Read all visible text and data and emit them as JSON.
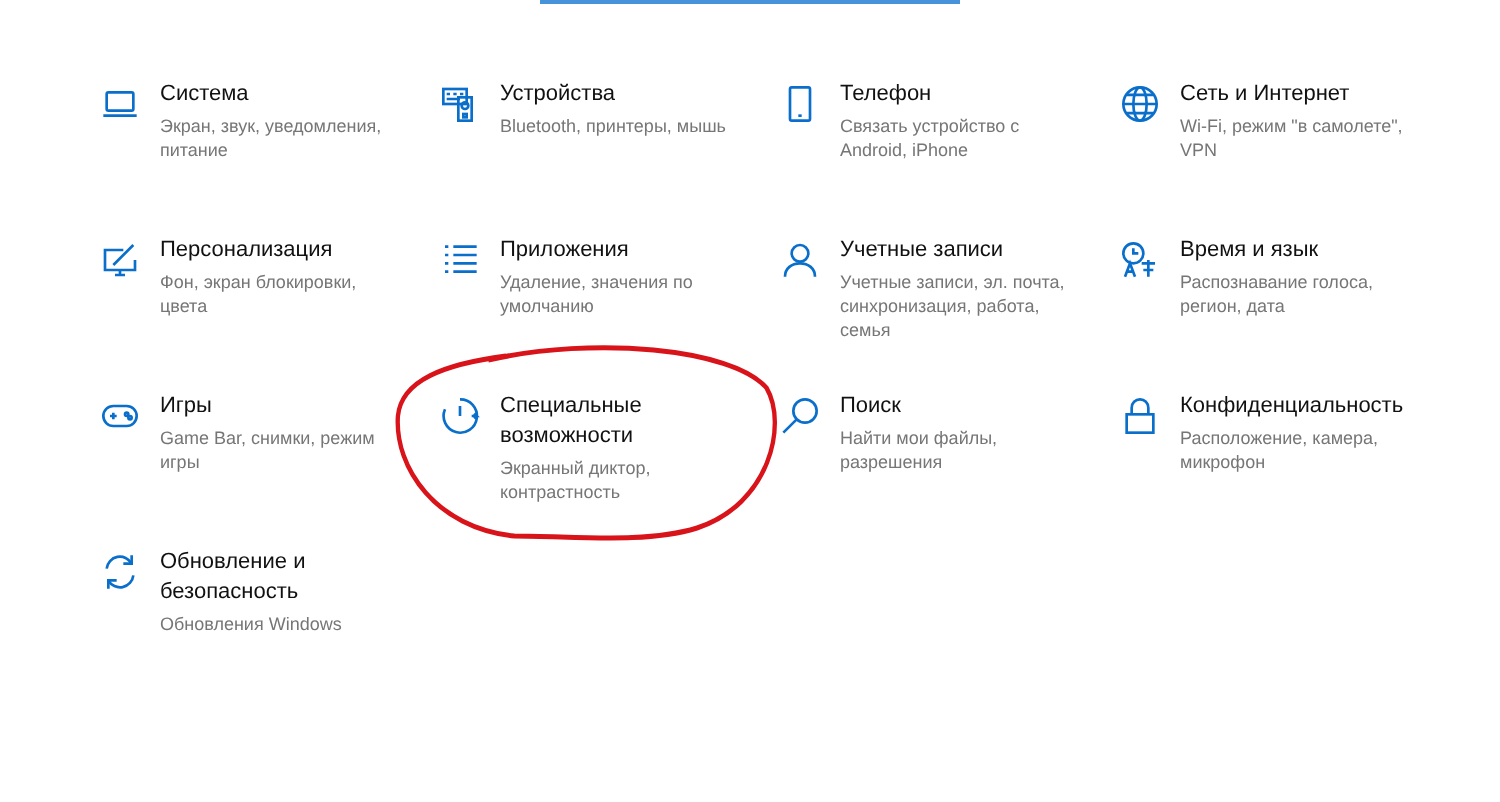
{
  "categories": [
    {
      "title": "Система",
      "description": "Экран, звук, уведомления, питание"
    },
    {
      "title": "Устройства",
      "description": "Bluetooth, принтеры, мышь"
    },
    {
      "title": "Телефон",
      "description": "Связать устройство с Android, iPhone"
    },
    {
      "title": "Сеть и Интернет",
      "description": "Wi-Fi, режим \"в самолете\", VPN"
    },
    {
      "title": "Персонализация",
      "description": "Фон, экран блокировки, цвета"
    },
    {
      "title": "Приложения",
      "description": "Удаление, значения по умолчанию"
    },
    {
      "title": "Учетные записи",
      "description": "Учетные записи, эл. почта, синхронизация, работа, семья"
    },
    {
      "title": "Время и язык",
      "description": "Распознавание голоса, регион, дата"
    },
    {
      "title": "Игры",
      "description": "Game Bar, снимки, режим игры"
    },
    {
      "title": "Специальные возможности",
      "description": "Экранный диктор, контрастность"
    },
    {
      "title": "Поиск",
      "description": "Найти мои файлы, разрешения"
    },
    {
      "title": "Конфиденциальность",
      "description": "Расположение, камера, микрофон"
    },
    {
      "title": "Обновление и безопасность",
      "description": "Обновления Windows"
    }
  ]
}
